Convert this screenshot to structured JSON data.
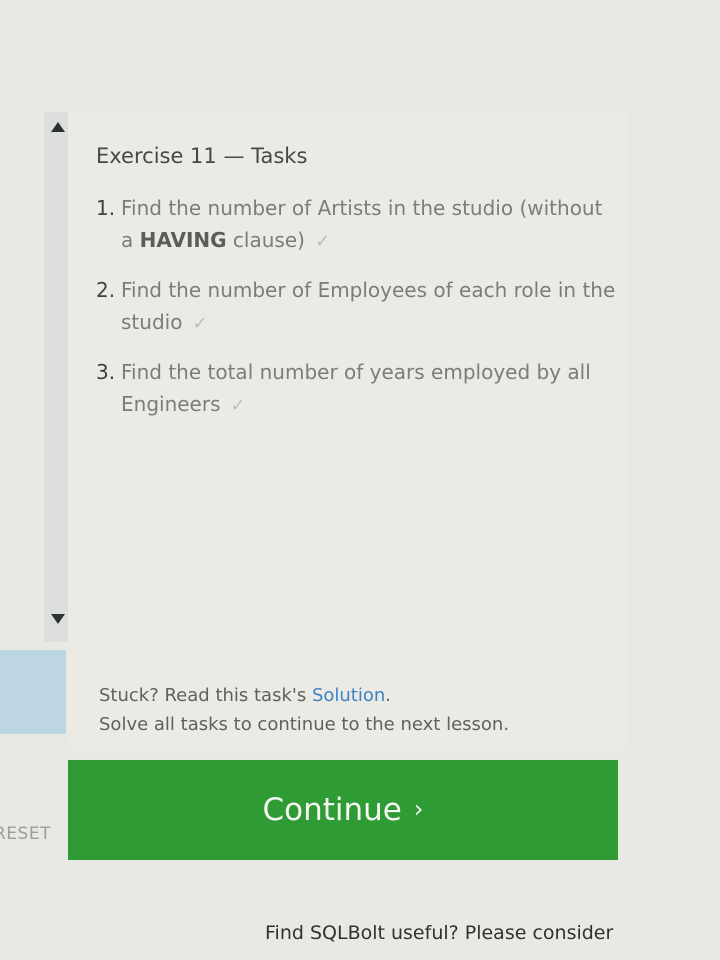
{
  "tasks": {
    "heading": "Exercise 11 — Tasks",
    "items": [
      {
        "number": "1.",
        "text_before": "Find the number of Artists in the studio (without a ",
        "strong": "HAVING",
        "text_after": " clause)",
        "check": "✓"
      },
      {
        "number": "2.",
        "text": "Find the number of Employees of each role in the studio",
        "check": "✓"
      },
      {
        "number": "3.",
        "text": "Find the total number of years employed by all Engineers",
        "check": "✓"
      }
    ]
  },
  "help": {
    "stuck_prefix": "Stuck? Read this task's ",
    "solution_link": "Solution",
    "stuck_suffix": ".",
    "solve_all": "Solve all tasks to continue to the next lesson."
  },
  "actions": {
    "continue_label": "Continue",
    "continue_chevron": "›",
    "reset_label": "RESET"
  },
  "footer": {
    "useful_text": "Find SQLBolt useful? Please consider"
  },
  "colors": {
    "continue_bg": "#2f9b35",
    "link": "#3b84c4"
  }
}
